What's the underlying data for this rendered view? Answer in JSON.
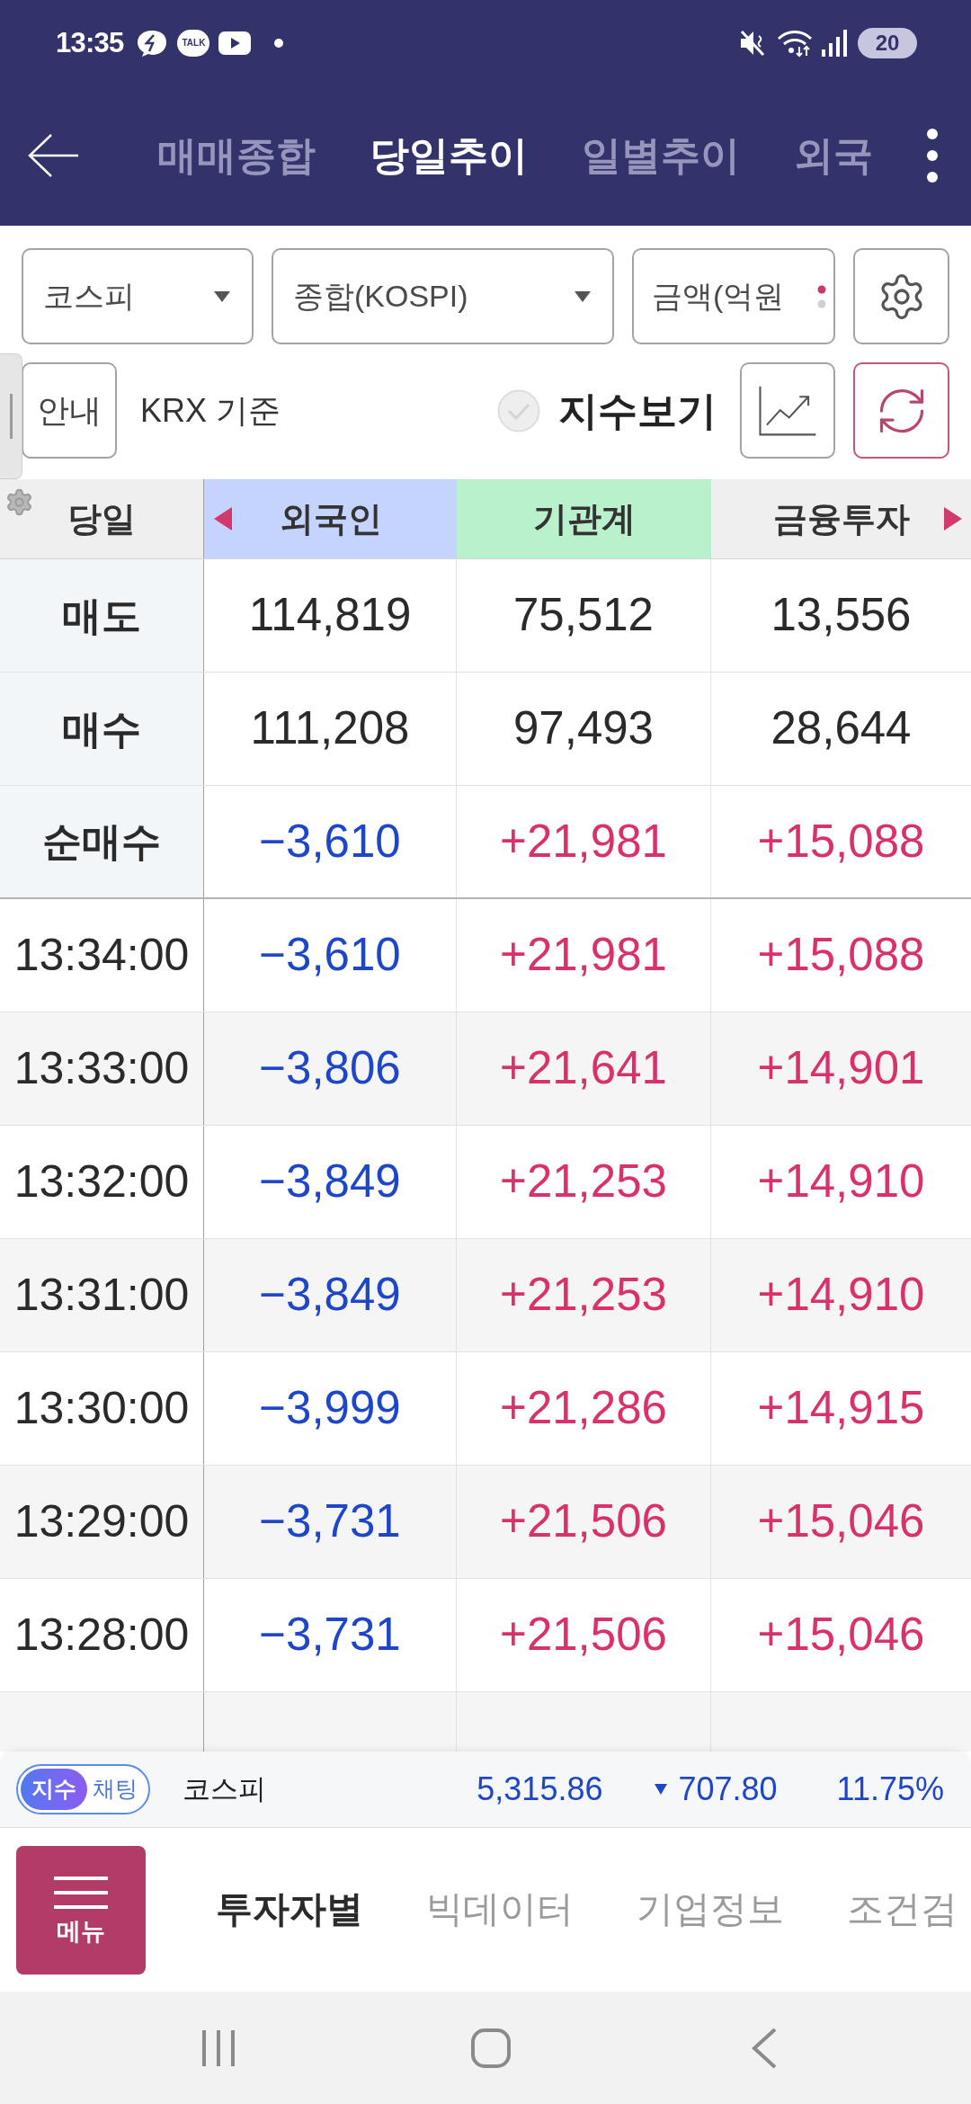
{
  "status_bar": {
    "time": "13:35",
    "talk_label": "TALK",
    "battery": "20"
  },
  "header": {
    "tabs": [
      {
        "label": "매매종합",
        "selected": false
      },
      {
        "label": "당일추이",
        "selected": true
      },
      {
        "label": "일별추이",
        "selected": false
      },
      {
        "label": "외국",
        "selected": false
      }
    ]
  },
  "filters": {
    "market": "코스피",
    "index": "종합(KOSPI)",
    "unit": "금액(억원"
  },
  "options": {
    "guide_button": "안내",
    "basis": "KRX 기준",
    "index_toggle": {
      "label": "지수보기",
      "checked": false
    }
  },
  "table": {
    "columns": [
      {
        "label": "당일",
        "color": "#efefef"
      },
      {
        "label": "외국인",
        "color": "#c5d4fe"
      },
      {
        "label": "기관계",
        "color": "#b9f1cd"
      },
      {
        "label": "금융투자",
        "color": "#efefef"
      }
    ],
    "rows": [
      {
        "kind": "summary",
        "cells": [
          {
            "value": "매도"
          },
          {
            "value": "114,819"
          },
          {
            "value": "75,512"
          },
          {
            "value": "13,556"
          }
        ]
      },
      {
        "kind": "summary",
        "cells": [
          {
            "value": "매수"
          },
          {
            "value": "111,208"
          },
          {
            "value": "97,493"
          },
          {
            "value": "28,644"
          }
        ]
      },
      {
        "kind": "summary",
        "cells": [
          {
            "value": "순매수"
          },
          {
            "value": "−3,610",
            "color": "#1d46c8"
          },
          {
            "value": "+21,981",
            "color": "#d8316b"
          },
          {
            "value": "+15,088",
            "color": "#d8316b"
          }
        ]
      },
      {
        "kind": "time",
        "cells": [
          {
            "value": "13:34:00"
          },
          {
            "value": "−3,610",
            "color": "#1d46c8"
          },
          {
            "value": "+21,981",
            "color": "#d8316b"
          },
          {
            "value": "+15,088",
            "color": "#d8316b"
          }
        ]
      },
      {
        "kind": "time",
        "cells": [
          {
            "value": "13:33:00"
          },
          {
            "value": "−3,806",
            "color": "#1d46c8"
          },
          {
            "value": "+21,641",
            "color": "#d8316b"
          },
          {
            "value": "+14,901",
            "color": "#d8316b"
          }
        ]
      },
      {
        "kind": "time",
        "cells": [
          {
            "value": "13:32:00"
          },
          {
            "value": "−3,849",
            "color": "#1d46c8"
          },
          {
            "value": "+21,253",
            "color": "#d8316b"
          },
          {
            "value": "+14,910",
            "color": "#d8316b"
          }
        ]
      },
      {
        "kind": "time",
        "cells": [
          {
            "value": "13:31:00"
          },
          {
            "value": "−3,849",
            "color": "#1d46c8"
          },
          {
            "value": "+21,253",
            "color": "#d8316b"
          },
          {
            "value": "+14,910",
            "color": "#d8316b"
          }
        ]
      },
      {
        "kind": "time",
        "cells": [
          {
            "value": "13:30:00"
          },
          {
            "value": "−3,999",
            "color": "#1d46c8"
          },
          {
            "value": "+21,286",
            "color": "#d8316b"
          },
          {
            "value": "+14,915",
            "color": "#d8316b"
          }
        ]
      },
      {
        "kind": "time",
        "cells": [
          {
            "value": "13:29:00"
          },
          {
            "value": "−3,731",
            "color": "#1d46c8"
          },
          {
            "value": "+21,506",
            "color": "#d8316b"
          },
          {
            "value": "+15,046",
            "color": "#d8316b"
          }
        ]
      },
      {
        "kind": "time",
        "cells": [
          {
            "value": "13:28:00"
          },
          {
            "value": "−3,731",
            "color": "#1d46c8"
          },
          {
            "value": "+21,506",
            "color": "#d8316b"
          },
          {
            "value": "+15,046",
            "color": "#d8316b"
          }
        ]
      }
    ]
  },
  "ticker": {
    "badge": {
      "active": "지수",
      "label": "채팅"
    },
    "name": "코스피",
    "price": "5,315.86",
    "change": "707.80",
    "rate": "11.75%",
    "falling": true
  },
  "bottom_nav": {
    "menu_button": "메뉴",
    "tabs": [
      {
        "label": "투자자별",
        "selected": true
      },
      {
        "label": "빅데이터",
        "selected": false
      },
      {
        "label": "기업정보",
        "selected": false
      },
      {
        "label": "조건검",
        "selected": false
      }
    ]
  }
}
